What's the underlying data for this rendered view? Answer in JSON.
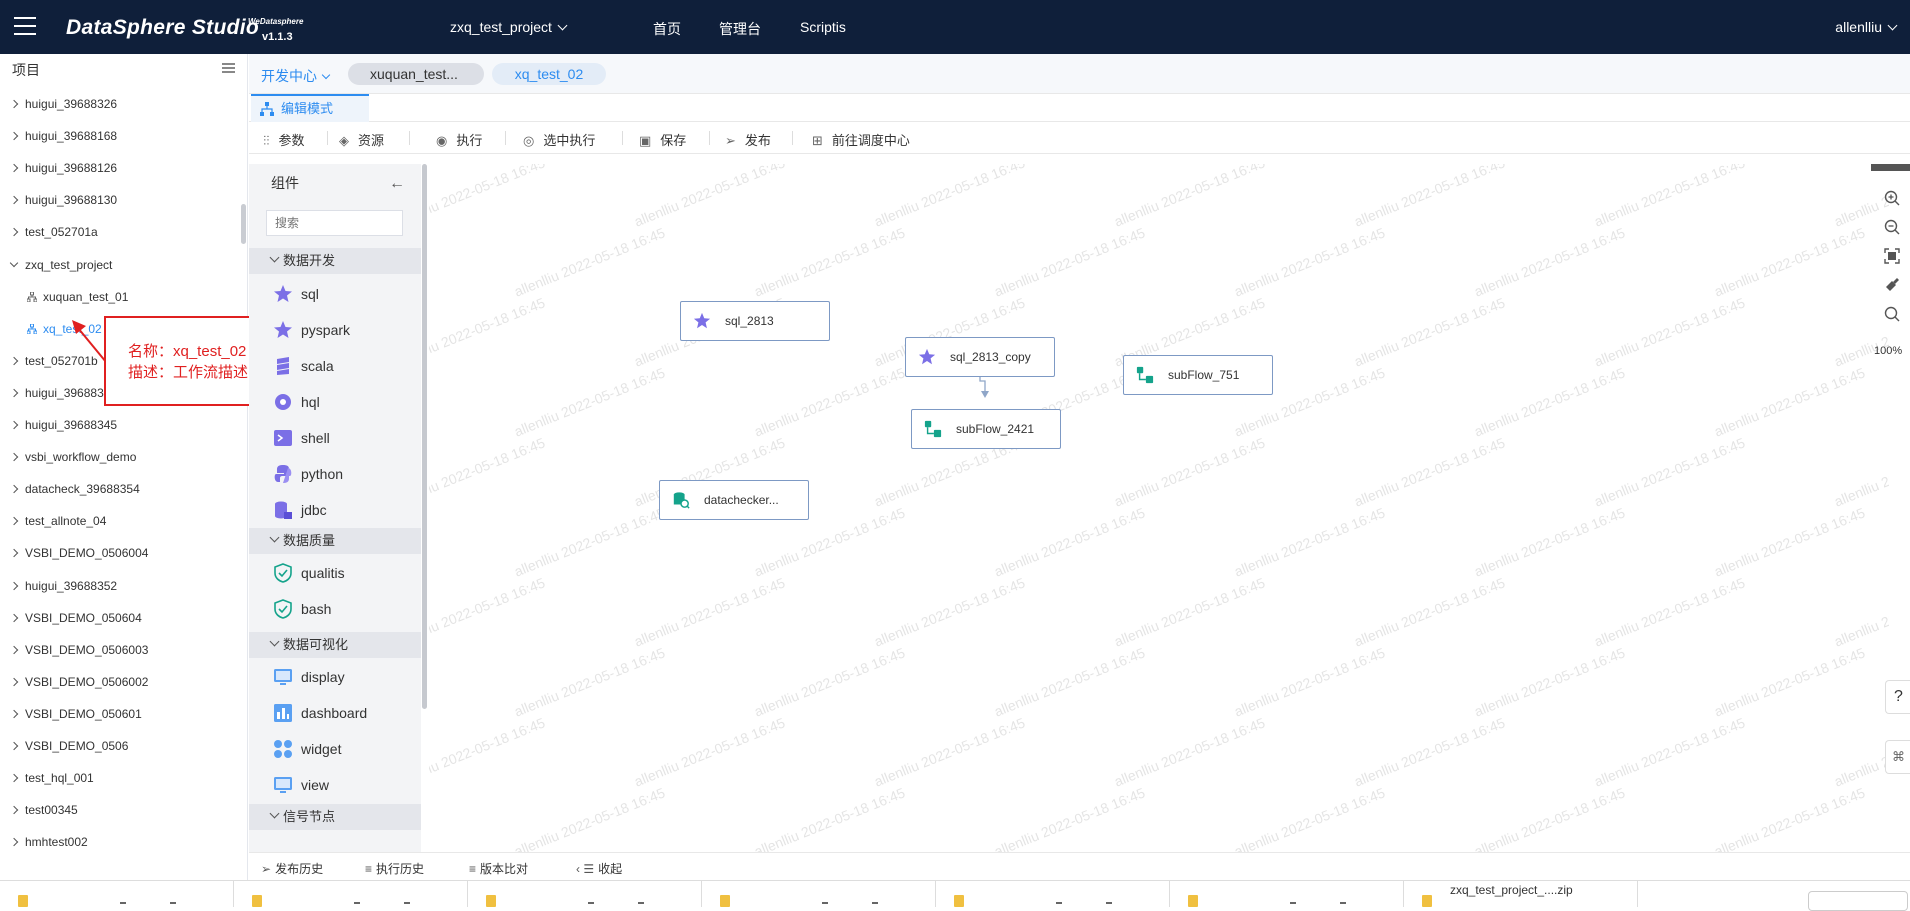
{
  "header": {
    "brand": "DataSphere Studio",
    "brand_sub": "WeDatasphere",
    "version": "v1.1.3",
    "project_select": "zxq_test_project",
    "nav": [
      "首页",
      "管理台",
      "Scriptis"
    ],
    "user": "allenlliu"
  },
  "sidebar": {
    "title": "项目",
    "items": [
      {
        "label": "huigui_39688326",
        "type": "collapsed"
      },
      {
        "label": "huigui_39688168",
        "type": "collapsed"
      },
      {
        "label": "huigui_39688126",
        "type": "collapsed"
      },
      {
        "label": "huigui_39688130",
        "type": "collapsed"
      },
      {
        "label": "test_052701a",
        "type": "collapsed"
      },
      {
        "label": "zxq_test_project",
        "type": "expanded"
      },
      {
        "label": "xuquan_test_01",
        "type": "child"
      },
      {
        "label": "xq_test_02",
        "type": "child-active"
      },
      {
        "label": "test_052701b",
        "type": "collapsed"
      },
      {
        "label": "huigui_39688335",
        "type": "collapsed"
      },
      {
        "label": "huigui_39688345",
        "type": "collapsed"
      },
      {
        "label": "vsbi_workflow_demo",
        "type": "collapsed"
      },
      {
        "label": "datacheck_39688354",
        "type": "collapsed"
      },
      {
        "label": "test_allnote_04",
        "type": "collapsed"
      },
      {
        "label": "VSBI_DEMO_0506004",
        "type": "collapsed"
      },
      {
        "label": "huigui_39688352",
        "type": "collapsed"
      },
      {
        "label": "VSBI_DEMO_050604",
        "type": "collapsed"
      },
      {
        "label": "VSBI_DEMO_0506003",
        "type": "collapsed"
      },
      {
        "label": "VSBI_DEMO_0506002",
        "type": "collapsed"
      },
      {
        "label": "VSBI_DEMO_050601",
        "type": "collapsed"
      },
      {
        "label": "VSBI_DEMO_0506",
        "type": "collapsed"
      },
      {
        "label": "test_hql_001",
        "type": "collapsed"
      },
      {
        "label": "test00345",
        "type": "collapsed"
      },
      {
        "label": "hmhtest002",
        "type": "collapsed"
      }
    ]
  },
  "tooltip": {
    "name_line": "名称：xq_test_02",
    "desc_line": "描述：工作流描述"
  },
  "tabs": {
    "dev_center": "开发中心",
    "tab_a": "xuquan_test...",
    "tab_b": "xq_test_02"
  },
  "mode": {
    "edit_mode": "编辑模式"
  },
  "toolbar": {
    "params": "参数",
    "resources": "资源",
    "execute": "执行",
    "execute_selected": "选中执行",
    "save": "保存",
    "publish": "发布",
    "goto_scheduler": "前往调度中心"
  },
  "palette": {
    "title": "组件",
    "search_placeholder": "搜索",
    "groups": {
      "dev": "数据开发",
      "quality": "数据质量",
      "visual": "数据可视化",
      "signal": "信号节点"
    },
    "nodes": {
      "sql": "sql",
      "pyspark": "pyspark",
      "scala": "scala",
      "hql": "hql",
      "shell": "shell",
      "python": "python",
      "jdbc": "jdbc",
      "qualitis": "qualitis",
      "bash": "bash",
      "display": "display",
      "dashboard": "dashboard",
      "widget": "widget",
      "view": "view"
    }
  },
  "canvas": {
    "watermark": "allenlliu 2022-05-18 16:45",
    "nodes": [
      {
        "label": "sql_2813",
        "kind": "sql"
      },
      {
        "label": "sql_2813_copy",
        "kind": "sql"
      },
      {
        "label": "subFlow_751",
        "kind": "subflow"
      },
      {
        "label": "subFlow_2421",
        "kind": "subflow"
      },
      {
        "label": "datachecker...",
        "kind": "datachecker"
      }
    ],
    "zoom": "100%"
  },
  "bottom": {
    "publish_history": "发布历史",
    "exec_history": "执行历史",
    "version_compare": "版本比对",
    "collapse": "收起"
  },
  "downloads": {
    "last_file": "zxq_test_project_....zip"
  },
  "help": {
    "label": "?"
  },
  "colors": {
    "header_bg": "#0f1f3a",
    "accent": "#2d8cf0",
    "annotation_red": "#e02020",
    "node_icon": "#6c5ce7",
    "subflow_icon": "#14a38b"
  }
}
